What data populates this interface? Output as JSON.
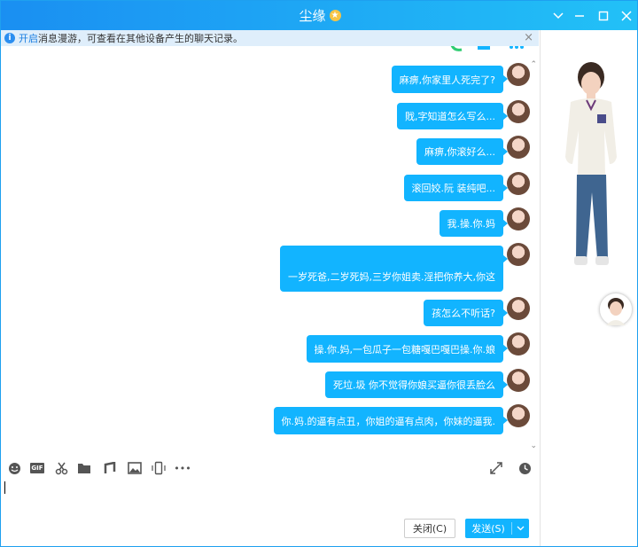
{
  "window": {
    "title": "尘缘",
    "star_icon": "star-icon",
    "controls": [
      "chevron-down-icon",
      "minimize-icon",
      "maximize-icon",
      "close-icon"
    ]
  },
  "notice": {
    "link_text": "开启",
    "text": "消息漫游，可查看在其他设备产生的聊天记录。",
    "close_glyph": "×"
  },
  "messages": [
    {
      "text": "麻痹,你家里人死完了?"
    },
    {
      "text": "戝,字知道怎么写么..."
    },
    {
      "text": "麻痹,你滚好么..."
    },
    {
      "text": "滚回姣.阮 装纯吧..."
    },
    {
      "text": "我.操.你.妈"
    },
    {
      "text": "一岁死爸,二岁死妈,三岁你姐卖.淫把你养大,你这"
    },
    {
      "text": "孩怎么不听话?"
    },
    {
      "text": "操.你.妈,一包瓜子一包糖嘎巴嘎巴操.你.娘"
    },
    {
      "text": "死垃.圾 你不觉得你娘买逼你很丢脸么"
    },
    {
      "text": "你.妈.的逼有点丑，你姐的逼有点肉，你妹的逼我."
    }
  ],
  "toolbar": {
    "icons": [
      "emoji-icon",
      "gif-icon",
      "scissors-icon",
      "folder-icon",
      "music-icon",
      "image-icon",
      "shake-icon",
      "more-icon"
    ],
    "gif_label": "GIF",
    "more_label": "•••",
    "right_icons": [
      "expand-icon",
      "history-clock-icon"
    ]
  },
  "buttons": {
    "close_label": "关闭(C)",
    "send_label": "发送(S)"
  },
  "colors": {
    "accent": "#12b4ff",
    "title_gradient_start": "#1a8ff2",
    "title_gradient_end": "#22c1f7"
  }
}
